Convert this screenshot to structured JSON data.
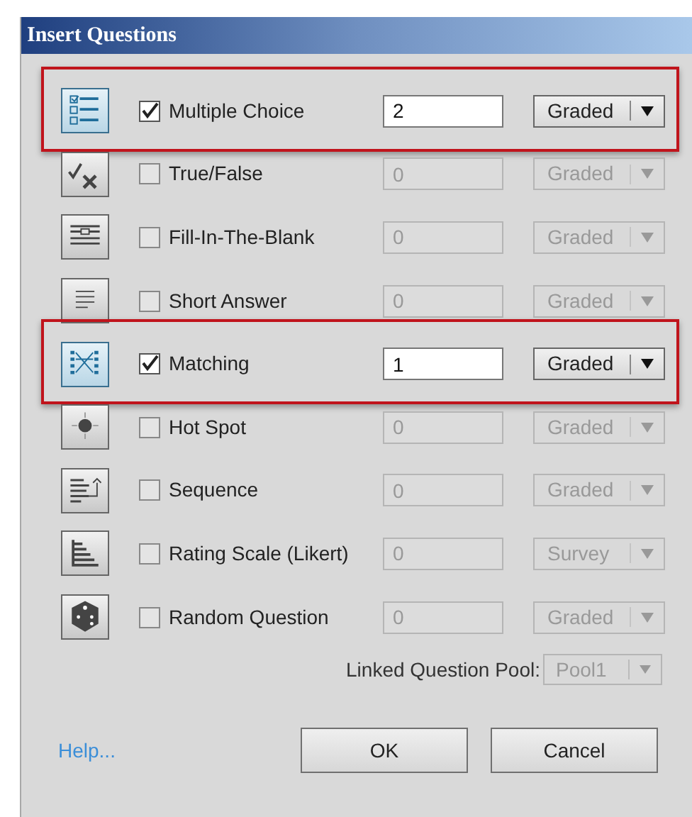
{
  "window": {
    "title": "Insert Questions"
  },
  "question_types": [
    {
      "kind": "multiple-choice",
      "label": "Multiple Choice",
      "checked": true,
      "highlighted": true,
      "count": "2",
      "grading": "Graded"
    },
    {
      "kind": "true-false",
      "label": "True/False",
      "checked": false,
      "highlighted": false,
      "count": "0",
      "grading": "Graded"
    },
    {
      "kind": "fill-blank",
      "label": "Fill-In-The-Blank",
      "checked": false,
      "highlighted": false,
      "count": "0",
      "grading": "Graded"
    },
    {
      "kind": "short-answer",
      "label": "Short Answer",
      "checked": false,
      "highlighted": false,
      "count": "0",
      "grading": "Graded"
    },
    {
      "kind": "matching",
      "label": "Matching",
      "checked": true,
      "highlighted": true,
      "count": "1",
      "grading": "Graded"
    },
    {
      "kind": "hot-spot",
      "label": "Hot Spot",
      "checked": false,
      "highlighted": false,
      "count": "0",
      "grading": "Graded"
    },
    {
      "kind": "sequence",
      "label": "Sequence",
      "checked": false,
      "highlighted": false,
      "count": "0",
      "grading": "Graded"
    },
    {
      "kind": "rating-scale",
      "label": "Rating Scale (Likert)",
      "checked": false,
      "highlighted": false,
      "count": "0",
      "grading": "Survey"
    },
    {
      "kind": "random",
      "label": "Random Question",
      "checked": false,
      "highlighted": false,
      "count": "0",
      "grading": "Graded"
    }
  ],
  "linked_pool": {
    "label": "Linked Question Pool:",
    "value": "Pool1",
    "disabled": true
  },
  "help_link": "Help...",
  "buttons": [
    {
      "label": "OK"
    },
    {
      "label": "Cancel"
    }
  ]
}
